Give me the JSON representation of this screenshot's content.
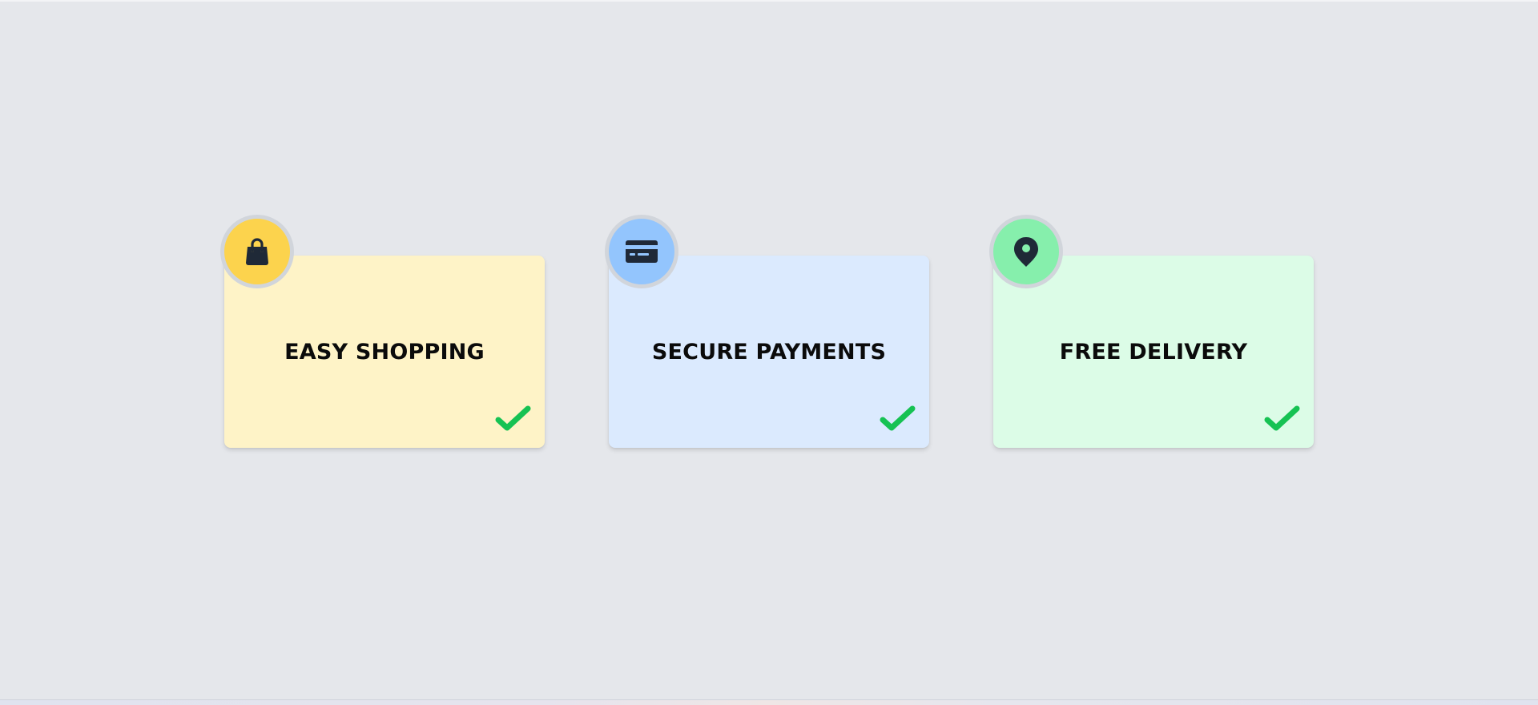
{
  "features": [
    {
      "title": "EASY SHOPPING",
      "icon": "shopping-bag-icon",
      "card_color": "#fef3c7",
      "badge_color": "#fcd34d",
      "completed": true
    },
    {
      "title": "SECURE PAYMENTS",
      "icon": "credit-card-icon",
      "card_color": "#dbeafe",
      "badge_color": "#93c5fd",
      "completed": true
    },
    {
      "title": "FREE DELIVERY",
      "icon": "map-pin-icon",
      "card_color": "#dcfce7",
      "badge_color": "#86efac",
      "completed": true
    }
  ],
  "colors": {
    "page_background": "#e5e7eb",
    "icon_dark": "#1f2937",
    "check_green": "#16c253",
    "badge_ring": "#d1d5db"
  }
}
